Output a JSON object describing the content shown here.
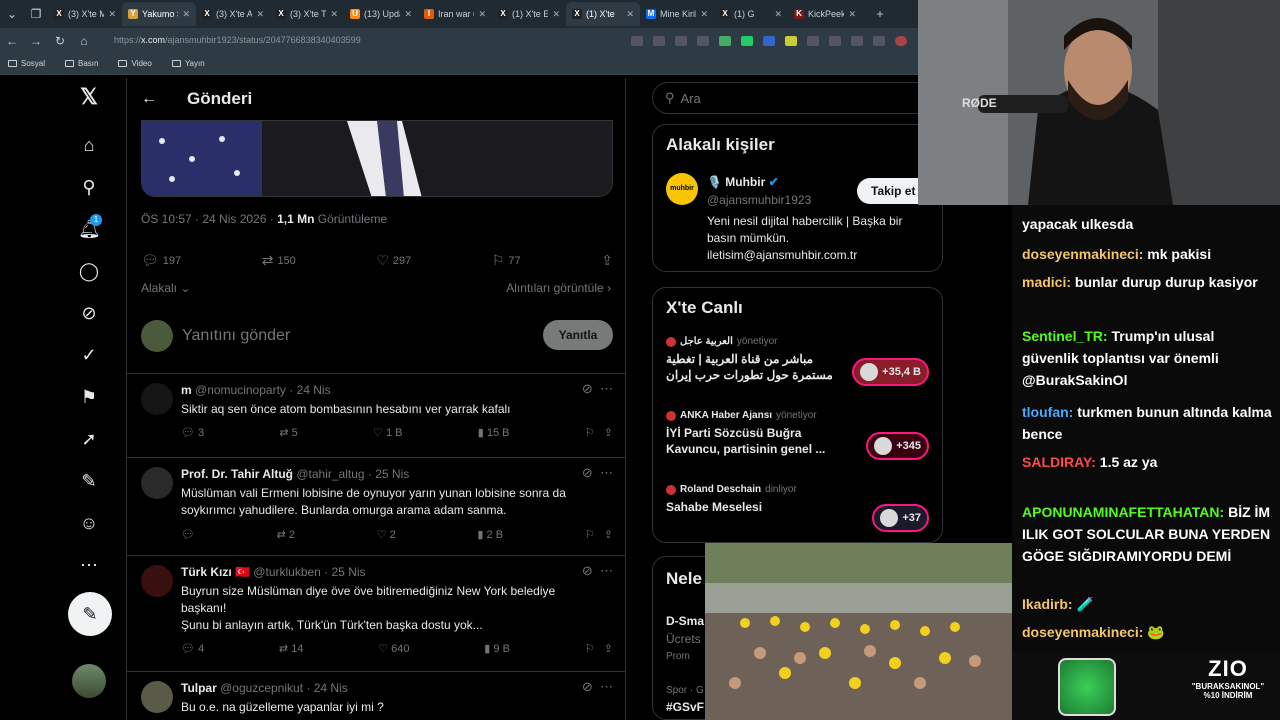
{
  "browser": {
    "tabs": [
      {
        "label": "(3) X'te Mi",
        "fav": "X",
        "active": false
      },
      {
        "label": "Yakumo Sl",
        "fav": "Y",
        "active": true
      },
      {
        "label": "(3) X'te Ai",
        "fav": "X",
        "active": false
      },
      {
        "label": "(3) X'te Th",
        "fav": "X",
        "active": false
      },
      {
        "label": "(13) Upda",
        "fav": "U",
        "active": false
      },
      {
        "label": "Iran war u",
        "fav": "I",
        "active": false
      },
      {
        "label": "(1) X'te Eti",
        "fav": "X",
        "active": false
      },
      {
        "label": "(1) X'te",
        "fav": "X",
        "active": true
      },
      {
        "label": "Mine Kirik",
        "fav": "M",
        "active": false
      },
      {
        "label": "(1) G",
        "fav": "X",
        "active": false
      },
      {
        "label": "KickPeek",
        "fav": "K",
        "active": false
      }
    ],
    "url_prefix": "https://",
    "url_domain": "x.com",
    "url_path": "/ajansmuhbir1923/status/2047766838340403599",
    "bookmarks": [
      "Sosyal",
      "Basın",
      "Video",
      "Yayın"
    ]
  },
  "header": {
    "title": "Gönderi"
  },
  "post": {
    "time": "ÖS 10:57 · 24 Nis 2026 · ",
    "views_count": "1,1 Mn",
    "views_label": " Görüntüleme",
    "replies": "197",
    "reposts": "150",
    "likes": "297",
    "bookmarks": "77",
    "relevance": "Alakalı",
    "quotes_link": "Alıntıları görüntüle",
    "reply_placeholder": "Yanıtını gönder",
    "reply_button": "Yanıtla"
  },
  "replies": [
    {
      "name": "m",
      "handle": "@nomucinoparty · 24 Nis",
      "text": "Siktir aq sen önce atom bombasının hesabını ver yarrak kafalı",
      "replies": "3",
      "reposts": "5",
      "likes": "1 B",
      "views": "15 B"
    },
    {
      "name": "Prof. Dr. Tahir Altuğ",
      "handle": "@tahir_altug · 25 Nis",
      "text": "Müslüman vali Ermeni lobisine de oynuyor yarın yunan lobisine sonra da soykırımcı yahudilere. Bunlarda omurga arama adam sanma.",
      "replies": "",
      "reposts": "2",
      "likes": "2",
      "views": "2 B"
    },
    {
      "name": "Türk Kızı 🇹🇷",
      "handle": "@turklukben · 25 Nis",
      "text": "Buyrun size Müslüman diye öve öve bitiremediğiniz New York belediye başkanı!\nŞunu bi anlayın artık, Türk'ün Türk'ten başka dostu yok...",
      "replies": "4",
      "reposts": "14",
      "likes": "640",
      "views": "9 B"
    },
    {
      "name": "Tulpar",
      "handle": "@oguzcepnikut · 24 Nis",
      "text": "Bu o.e. na güzelleme yapanlar iyi mi ?",
      "replies": "",
      "reposts": "",
      "likes": "",
      "views": ""
    }
  ],
  "sidebar": {
    "search_placeholder": "Ara",
    "related_title": "Alakalı kişiler",
    "related_name": "🎙️ Muhbir",
    "related_handle": "@ajansmuhbir1923",
    "related_avatar_text": "muhbir",
    "follow_button": "Takip et",
    "related_bio": "Yeni nesil dijital habercilik | Başka bir basın mümkün. iletisim@ajansmuhbir.com.tr",
    "live_title": "X'te Canlı",
    "live": [
      {
        "host": "العربية عاجل",
        "role": "yönetiyor",
        "title": "مباشر من قناة العربية | تغطية مستمرة حول تطورات حرب إيران",
        "badge": "+35,4 B"
      },
      {
        "host": "ANKA Haber Ajansı",
        "role": "yönetiyor",
        "title": "İYİ Parti Sözcüsü Buğra Kavuncu, partisinin genel ...",
        "badge": "+345"
      },
      {
        "host": "Roland Deschain",
        "role": "dinliyor",
        "title": "Sahabe Meselesi",
        "badge": "+37"
      }
    ],
    "news_title": "Nele",
    "news_lines": [
      "D-Sma",
      "Ücrets",
      "Prom"
    ],
    "sport_line": "Spor · G",
    "sport_tag": "#GSvF"
  },
  "chat": [
    {
      "user": "",
      "text": "yapacak ulkesda",
      "color": "#ffffff"
    },
    {
      "user": "doseyenmakineci:",
      "text": " mk pakisi",
      "color": "#f4c56b"
    },
    {
      "user": "madici:",
      "text": " bunlar durup durup kasiyor",
      "color": "#f4c56b"
    },
    {
      "user": "Sentinel_TR:",
      "text": " Trump'ın ulusal güvenlik toplantısı var önemli @BurakSakinOl",
      "color": "#53fc18"
    },
    {
      "user": "tloufan:",
      "text": " turkmen bunun altında kalma bence",
      "color": "#4aa8ff"
    },
    {
      "user": "SALDIRAY:",
      "text": " 1.5 az ya",
      "color": "#ff4a4a"
    },
    {
      "user": "APONUNAMINAFETTAHATAN:",
      "text": " BİZ İM ILIK GOT SOLCULAR BUNA YERDEN GÖGE SIĞDIRAMIYORDU DEMİ",
      "color": "#53fc18"
    },
    {
      "user": "Ikadirb:",
      "text": " 🧪",
      "color": "#f4c56b"
    },
    {
      "user": "doseyenmakineci:",
      "text": " 🐸",
      "color": "#f4c56b"
    }
  ],
  "overlay": {
    "promo_logo": "ZIO",
    "promo_line1": "\"BURAKSAKINOL\"",
    "promo_line2": "%10 İNDİRİM"
  },
  "colors": {
    "accent": "#1d9bf0",
    "live_border": "#f91880",
    "background": "#000000"
  }
}
